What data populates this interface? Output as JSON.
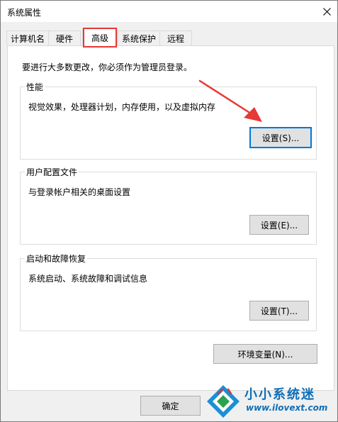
{
  "window": {
    "title": "系统属性"
  },
  "tabs": [
    {
      "label": "计算机名"
    },
    {
      "label": "硬件"
    },
    {
      "label": "高级",
      "active": true
    },
    {
      "label": "系统保护"
    },
    {
      "label": "远程"
    }
  ],
  "admin_note": "要进行大多数更改，你必须作为管理员登录。",
  "groups": {
    "performance": {
      "title": "性能",
      "description": "视觉效果，处理器计划，内存使用，以及虚拟内存",
      "button": "设置(S)..."
    },
    "user_profiles": {
      "title": "用户配置文件",
      "description": "与登录帐户相关的桌面设置",
      "button": "设置(E)..."
    },
    "startup_recovery": {
      "title": "启动和故障恢复",
      "description": "系统启动、系统故障和调试信息",
      "button": "设置(T)..."
    }
  },
  "env_button": "环境变量(N)...",
  "footer": {
    "ok": "确定"
  },
  "watermark": {
    "title": "小小系统迷",
    "url": "www.ilovext.com"
  },
  "colors": {
    "highlight": "#e53935",
    "focus": "#0078d7",
    "watermark": "#0d6eb8"
  }
}
